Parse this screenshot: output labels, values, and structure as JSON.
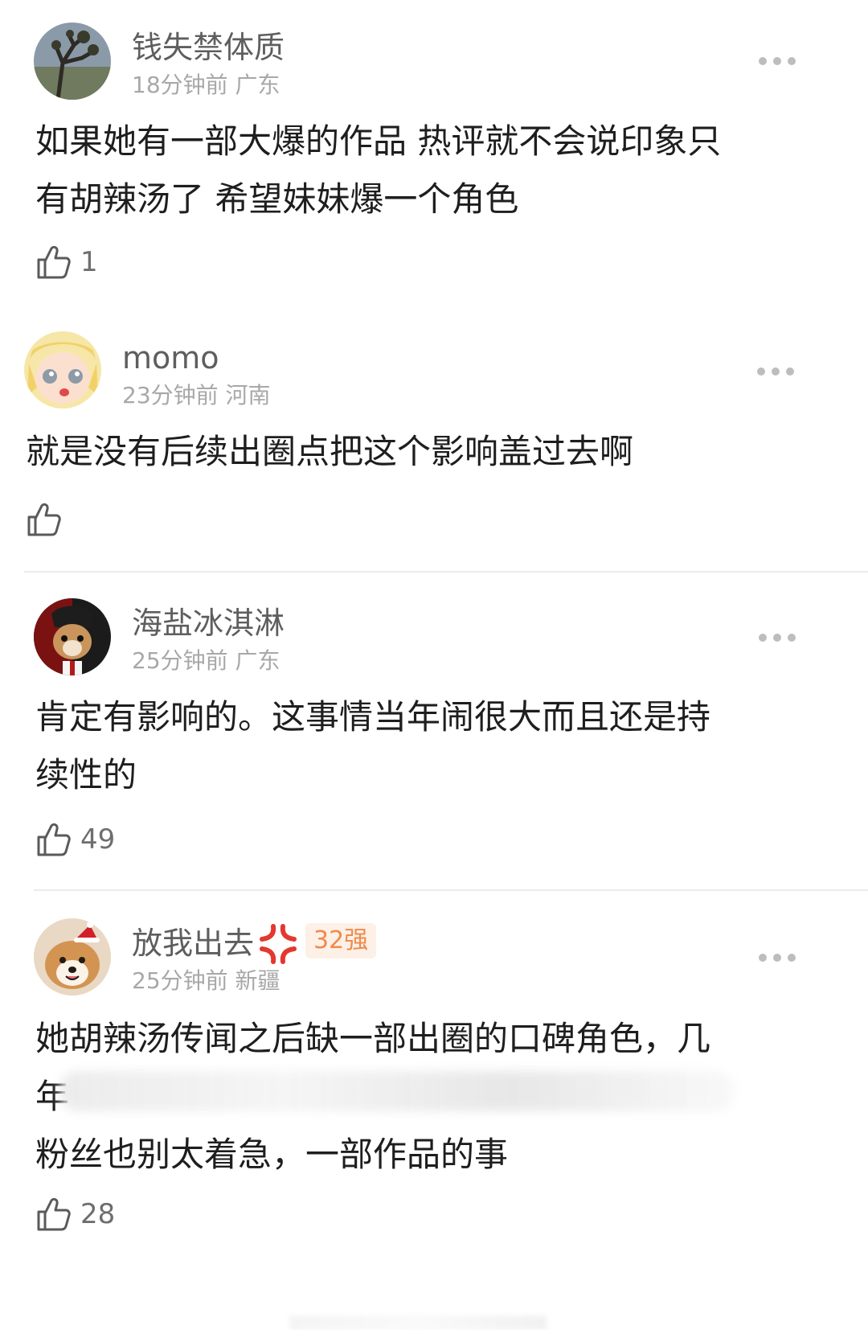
{
  "comments": [
    {
      "username": "钱失禁体质",
      "time": "18分钟前",
      "location": "广东",
      "text_lines": [
        "如果她有一部大爆的作品 热评就不会说印象只",
        "有胡辣汤了 希望妹妹爆一个角色"
      ],
      "likes": "1",
      "avatar_icon": "tree-avatar-icon"
    },
    {
      "username": "momo",
      "time": "23分钟前",
      "location": "河南",
      "text_lines": [
        "就是没有后续出圈点把这个影响盖过去啊"
      ],
      "likes": "",
      "avatar_icon": "anime-girl-avatar-icon"
    },
    {
      "username": "海盐冰淇淋",
      "time": "25分钟前",
      "location": "广东",
      "text_lines": [
        "肯定有影响的。这事情当年闹很大而且还是持",
        "续性的"
      ],
      "likes": "49",
      "avatar_icon": "cartoon-dog-avatar-icon"
    },
    {
      "username": "放我出去",
      "badge": "32强",
      "time": "25分钟前",
      "location": "新疆",
      "text_lines": [
        "她胡辣汤传闻之后缺一部出圈的口碑角色，几",
        "年",
        "粉丝也别太着急，一部作品的事"
      ],
      "likes": "28",
      "avatar_icon": "shiba-dog-avatar-icon"
    }
  ],
  "colors": {
    "username": "#5e5e5e",
    "meta": "#a8a8a8",
    "text": "#1e1e1e",
    "badge_bg": "#fdf0e6",
    "badge_fg": "#f08a4b",
    "divider": "#ececec"
  }
}
